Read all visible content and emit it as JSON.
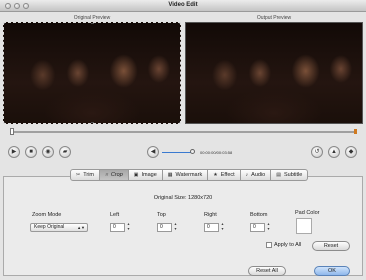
{
  "window": {
    "title": "Video Edit"
  },
  "preview": {
    "original_label": "Original Preview",
    "output_label": "Output Preview"
  },
  "playback": {
    "time": "00:00:00/00:03:58"
  },
  "tabs": [
    {
      "label": "Trim",
      "icon": "scissors-icon",
      "glyph": "✂"
    },
    {
      "label": "Crop",
      "icon": "crop-icon",
      "glyph": "⌗"
    },
    {
      "label": "Image",
      "icon": "image-icon",
      "glyph": "▣"
    },
    {
      "label": "Watermark",
      "icon": "watermark-icon",
      "glyph": "▦"
    },
    {
      "label": "Effect",
      "icon": "star-icon",
      "glyph": "★"
    },
    {
      "label": "Audio",
      "icon": "music-note-icon",
      "glyph": "♪"
    },
    {
      "label": "Subtitle",
      "icon": "subtitle-icon",
      "glyph": "▤"
    }
  ],
  "active_tab": "Crop",
  "crop": {
    "original_size": "Original Size: 1280x720",
    "zoom_mode_label": "Zoom Mode",
    "zoom_mode_value": "Keep Original",
    "left_label": "Left",
    "left_value": "0",
    "top_label": "Top",
    "top_value": "0",
    "right_label": "Right",
    "right_value": "0",
    "bottom_label": "Bottom",
    "bottom_value": "0",
    "pad_color_label": "Pad Color",
    "pad_color": "#ffffff",
    "apply_to_all_label": "Apply to All",
    "reset_label": "Reset"
  },
  "footer": {
    "reset_all_label": "Reset All",
    "ok_label": "OK"
  }
}
